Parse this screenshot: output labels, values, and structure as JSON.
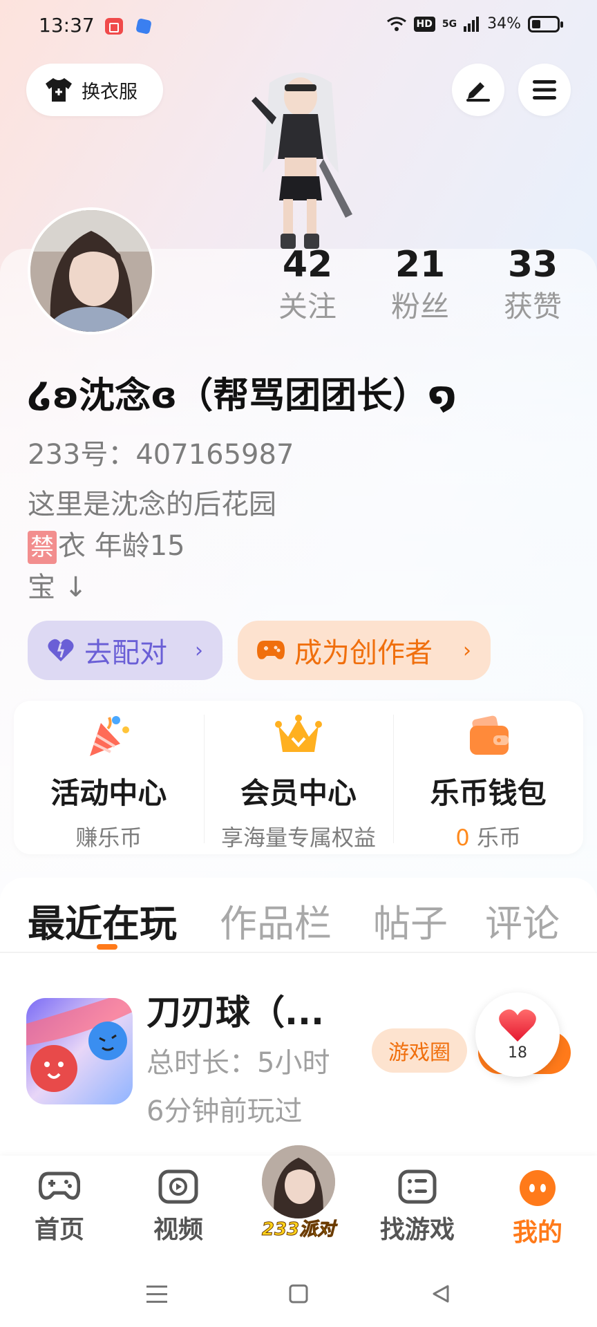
{
  "status_bar": {
    "time": "13:37",
    "network": "5G",
    "hd_badge": "HD",
    "battery": "34%"
  },
  "top": {
    "outfit_label": "换衣服",
    "edit_icon": "pen-icon",
    "menu_icon": "hamburger-menu-icon"
  },
  "stats": [
    {
      "value": "42",
      "label": "关注"
    },
    {
      "value": "21",
      "label": "粉丝"
    },
    {
      "value": "33",
      "label": "获赞"
    }
  ],
  "profile": {
    "nickname": "໒ʚ沈念ɞ（帮骂团团长）໑",
    "uid": "233号：407165987",
    "bio_line1": "这里是沈念的后花园",
    "bio_ban": "禁",
    "bio_line2": "衣 年龄15",
    "bio_line3": "宝 ↓"
  },
  "actions": {
    "match_label": "去配对",
    "creator_label": "成为创作者",
    "chevron": "›"
  },
  "quick": [
    {
      "title": "活动中心",
      "sub": "赚乐币",
      "icon": "party-popper-icon"
    },
    {
      "title": "会员中心",
      "sub": "享海量专属权益",
      "icon": "crown-icon"
    },
    {
      "title": "乐币钱包",
      "sub_value": "0",
      "sub_unit": "乐币",
      "icon": "wallet-icon"
    }
  ],
  "tabs": [
    "最近在玩",
    "作品栏",
    "帖子",
    "评论"
  ],
  "recent_game": {
    "name": "刀刃球（...",
    "total_time": "总时长：5小时",
    "last_played": "6分钟前玩过",
    "circle_label": "游戏圈",
    "like_count": "18"
  },
  "bottom_nav": [
    {
      "label": "首页",
      "icon": "gamepad-icon"
    },
    {
      "label": "视频",
      "icon": "video-play-icon"
    },
    {
      "label": "233派对",
      "icon": "party-avatar"
    },
    {
      "label": "找游戏",
      "icon": "list-icon"
    },
    {
      "label": "我的",
      "icon": "profile-face-icon"
    }
  ],
  "colors": {
    "accent_orange": "#ff7a1a",
    "match_purple": "#6a5fd6",
    "ban_red": "#f28e8e"
  }
}
